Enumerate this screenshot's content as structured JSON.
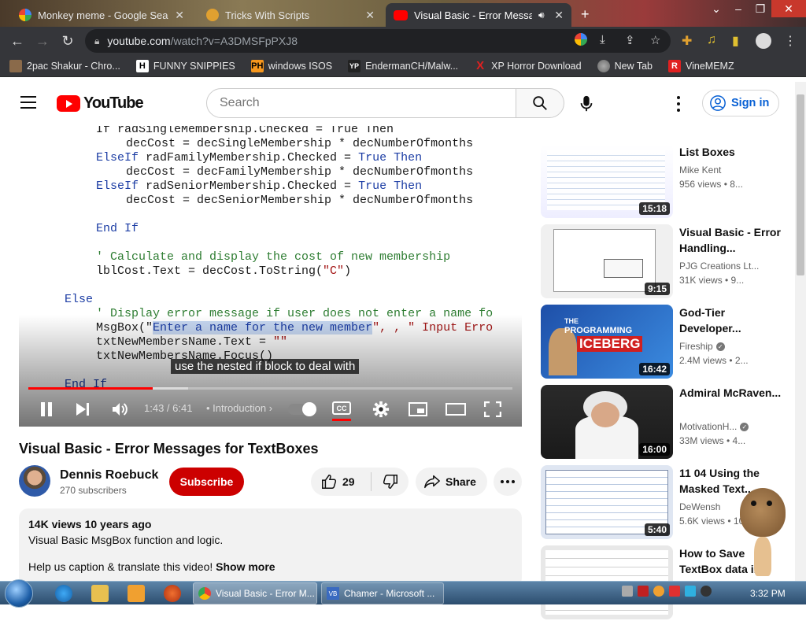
{
  "browser": {
    "tabs": [
      {
        "label": "Monkey meme - Google Search",
        "active": false
      },
      {
        "label": "Tricks With Scripts",
        "active": false
      },
      {
        "label": "Visual Basic - Error Messages",
        "active": true
      }
    ],
    "url_host": "youtube.com",
    "url_path": "/watch?v=A3DMSFpPXJ8",
    "bookmarks": [
      {
        "label": "2pac Shakur - Chro...",
        "icon": "bookmark-tupac-icon"
      },
      {
        "label": "FUNNY SNIPPIES",
        "icon": "H"
      },
      {
        "label": "windows ISOS",
        "icon": "PH"
      },
      {
        "label": "EndermanCH/Malw...",
        "icon": "YP"
      },
      {
        "label": "XP Horror Download",
        "icon": "X"
      },
      {
        "label": "New Tab",
        "icon": "globe-icon"
      },
      {
        "label": "VineMEMZ",
        "icon": "R"
      }
    ]
  },
  "youtube": {
    "logo_text": "YouTube",
    "search_placeholder": "Search",
    "signin_label": "Sign in"
  },
  "video": {
    "code_lines": [
      {
        "indent": 1,
        "parts": [
          [
            "t",
            "If radSingleMembership.Checked = True Then"
          ]
        ]
      },
      {
        "indent": 2,
        "parts": [
          [
            "t",
            "decCost = decSingleMembership * decNumberOfmonths"
          ]
        ]
      },
      {
        "indent": 1,
        "parts": [
          [
            "k",
            "ElseIf "
          ],
          [
            "t",
            "radFamilyMembership.Checked = "
          ],
          [
            "k",
            "True Then"
          ]
        ]
      },
      {
        "indent": 2,
        "parts": [
          [
            "t",
            "decCost = decFamilyMembership * decNumberOfmonths"
          ]
        ]
      },
      {
        "indent": 1,
        "parts": [
          [
            "k",
            "ElseIf "
          ],
          [
            "t",
            "radSeniorMembership.Checked = "
          ],
          [
            "k",
            "True Then"
          ]
        ]
      },
      {
        "indent": 2,
        "parts": [
          [
            "t",
            "decCost = decSeniorMembership * decNumberOfmonths"
          ]
        ]
      },
      {
        "indent": 1,
        "parts": []
      },
      {
        "indent": 1,
        "parts": [
          [
            "k",
            "End If"
          ]
        ]
      },
      {
        "indent": 1,
        "parts": []
      },
      {
        "indent": 1,
        "parts": [
          [
            "c",
            "' Calculate and display the cost of new membership"
          ]
        ]
      },
      {
        "indent": 1,
        "parts": [
          [
            "t",
            "lblCost.Text = decCost.ToString("
          ],
          [
            "s",
            "\"C\""
          ],
          [
            "t",
            ")"
          ]
        ]
      },
      {
        "indent": 0,
        "parts": []
      },
      {
        "indent": 0,
        "parts": [
          [
            "k",
            "Else"
          ]
        ]
      },
      {
        "indent": 1,
        "parts": [
          [
            "c",
            "' Display error message if user does not enter a name fo"
          ]
        ]
      },
      {
        "indent": 1,
        "parts": [
          [
            "t",
            "MsgBox(\""
          ],
          [
            "h",
            "Enter a name for the new member"
          ],
          [
            "s",
            "\", , \" Input Erro"
          ]
        ]
      },
      {
        "indent": 1,
        "parts": [
          [
            "t",
            "txtNewMembersName.Text = "
          ],
          [
            "s",
            "\"\""
          ]
        ]
      },
      {
        "indent": 1,
        "parts": [
          [
            "t",
            "txtNewMembersName.Focus()"
          ]
        ]
      },
      {
        "indent": 0,
        "parts": []
      },
      {
        "indent": 0,
        "parts": [
          [
            "k",
            "End If"
          ]
        ]
      }
    ],
    "caption": "use the nested if block to deal with",
    "time": "1:43 / 6:41",
    "chapter": "Introduction",
    "progress_fraction": 0.257,
    "buffered_fraction": 0.33,
    "title": "Visual Basic - Error Messages for TextBoxes"
  },
  "channel": {
    "name": "Dennis Roebuck",
    "subscribers": "270 subscribers",
    "subscribe_label": "Subscribe",
    "likes": "29",
    "share_label": "Share"
  },
  "description": {
    "meta": "14K views  10 years ago",
    "text": "Visual Basic MsgBox function and logic.",
    "text2": "Help us caption & translate this video!",
    "show_more": "Show more"
  },
  "recommendations": [
    {
      "title": "List Boxes",
      "channel": "Mike Kent",
      "verified": false,
      "meta": "956 views • 8...",
      "duration": "15:18",
      "thumb": "code"
    },
    {
      "title": "Visual Basic - Error Handling...",
      "channel": "PJG Creations Lt...",
      "verified": false,
      "meta": "31K views • 9...",
      "duration": "9:15",
      "thumb": "dialog"
    },
    {
      "title": "God-Tier Developer...",
      "channel": "Fireship",
      "verified": true,
      "meta": "2.4M views • 2...",
      "duration": "16:42",
      "thumb": "iceberg"
    },
    {
      "title": "Admiral McRaven...",
      "channel": "MotivationH...",
      "verified": true,
      "meta": "33M views • 4...",
      "duration": "16:00",
      "thumb": "admiral"
    },
    {
      "title": "11 04 Using the Masked Text...",
      "channel": "DeWensh",
      "verified": false,
      "meta": "5.6K views • 10...",
      "duration": "5:40",
      "thumb": "form"
    },
    {
      "title": "How to Save TextBox data i...",
      "channel": "",
      "verified": false,
      "meta": "",
      "duration": "",
      "thumb": "grid"
    }
  ],
  "thumb_text": {
    "iceberg_line1": "THE",
    "iceberg_line2": "PROGRAMMING",
    "iceberg_line3": "ICEBERG"
  },
  "taskbar": {
    "tasks": [
      "Visual Basic - Error M...",
      "Chamer - Microsoft ..."
    ],
    "clock": "3:32 PM"
  },
  "colors": {
    "youtube_red": "#ff0000",
    "subscribe": "#cc0000",
    "link_blue": "#065fd4",
    "chrome_dark": "#35363a"
  }
}
